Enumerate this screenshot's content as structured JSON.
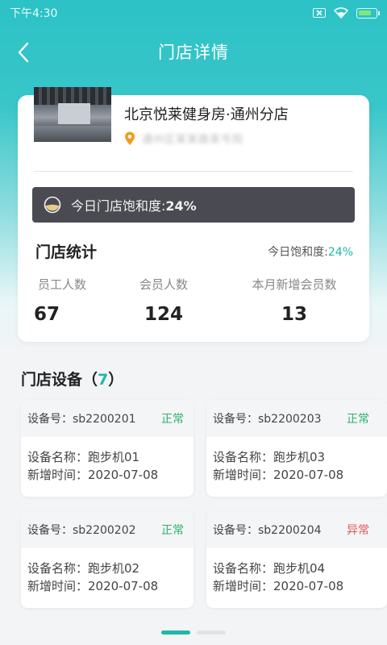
{
  "status_bar": {
    "time": "下午4:30"
  },
  "nav": {
    "title": "门店详情"
  },
  "store": {
    "name": "北京悦莱健身房·通州分店",
    "address": "通州区某某路某号院"
  },
  "saturation": {
    "label": "今日门店饱和度:",
    "value": "24%"
  },
  "stats": {
    "title": "门店统计",
    "right_label": "今日饱和度:",
    "right_value": "24%",
    "items": [
      {
        "label": "员工人数",
        "value": "67"
      },
      {
        "label": "会员人数",
        "value": "124"
      },
      {
        "label": "本月新增会员数",
        "value": "13"
      }
    ]
  },
  "devices": {
    "title": "门店设备",
    "count": "7",
    "items": [
      {
        "id_line": "设备号：sb2200201",
        "status": "正常",
        "status_color": "#2ab26a",
        "name_line": "设备名称：跑步机01",
        "date_line": "新增时间：2020-07-08"
      },
      {
        "id_line": "设备号：sb2200203",
        "status": "正常",
        "status_color": "#2ab26a",
        "name_line": "设备名称：跑步机03",
        "date_line": "新增时间：2020-07-08"
      },
      {
        "id_line": "设备号：sb2200202",
        "status": "正常",
        "status_color": "#2ab26a",
        "name_line": "设备名称：跑步机02",
        "date_line": "新增时间：2020-07-08"
      },
      {
        "id_line": "设备号：sb2200204",
        "status": "异常",
        "status_color": "#e25555",
        "name_line": "设备名称：跑步机04",
        "date_line": "新增时间：2020-07-08"
      }
    ]
  },
  "pager": {
    "active_color": "#20b7a8",
    "inactive_color": "#e2e2e2"
  }
}
